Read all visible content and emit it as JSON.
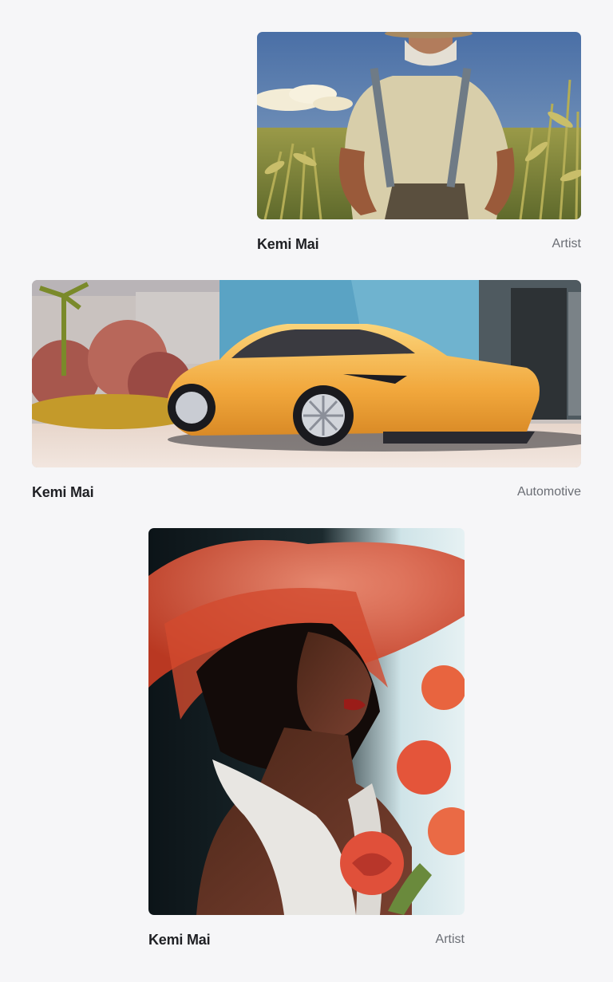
{
  "gallery": {
    "cards": [
      {
        "author": "Kemi Mai",
        "category": "Artist",
        "image": "farmer-in-cornfield-illustration"
      },
      {
        "author": "Kemi Mai",
        "category": "Automotive",
        "image": "yellow-sports-car-photo"
      },
      {
        "author": "Kemi Mai",
        "category": "Artist",
        "image": "woman-in-red-hat-portrait"
      }
    ]
  }
}
